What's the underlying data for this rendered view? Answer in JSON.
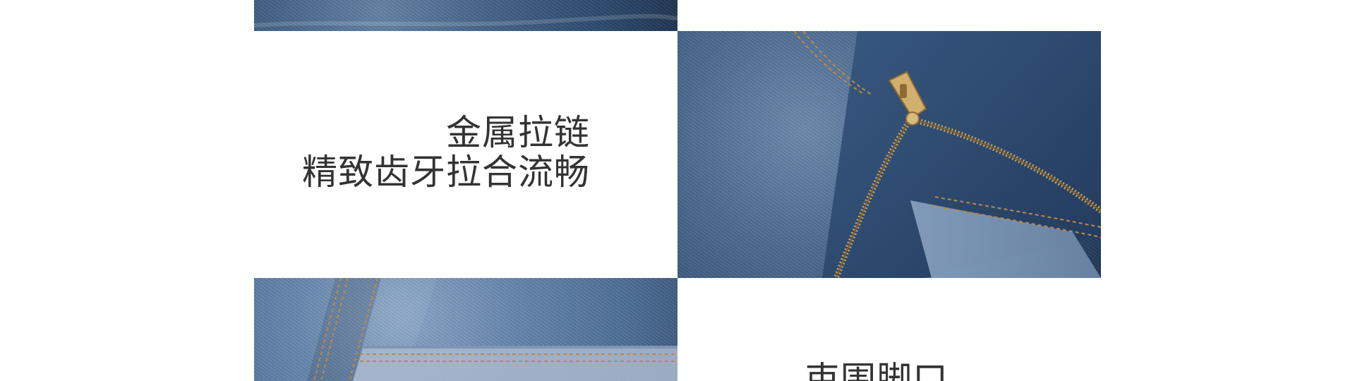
{
  "features": [
    {
      "title": "金属拉链",
      "subtitle": "精致齿牙拉合流畅"
    },
    {
      "title": "束围脚口"
    }
  ],
  "images": {
    "top_left": {
      "icon": "denim-photo-icon"
    },
    "zipper": {
      "icon": "zipper-photo-icon"
    },
    "bottom_left": {
      "icon": "denim-seam-photo-icon"
    }
  },
  "colors": {
    "text": "#333333",
    "background": "#ffffff",
    "denim_dark": "#2f4f78",
    "denim_mid": "#4b6d96",
    "denim_light": "#87a4c7",
    "zipper_gold": "#c9a35c",
    "stitch": "#b98a4a"
  }
}
